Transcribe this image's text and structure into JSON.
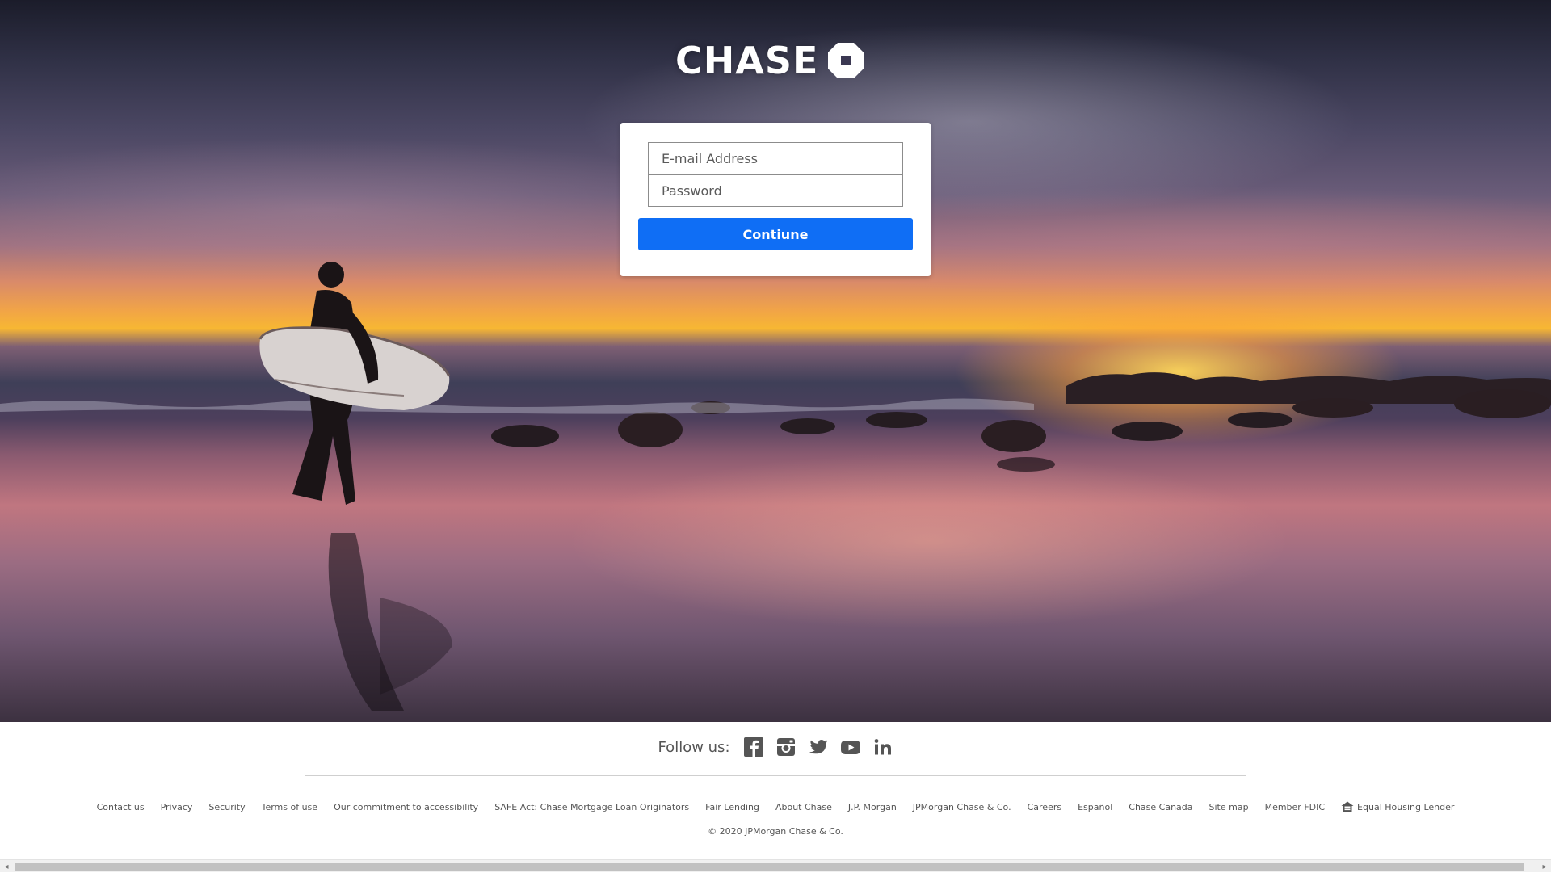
{
  "brand": {
    "name": "CHASE"
  },
  "login": {
    "email_placeholder": "E-mail Address",
    "password_placeholder": "Password",
    "continue_label": "Contiune",
    "button_color": "#0f6ef5"
  },
  "footer": {
    "follow_label": "Follow us:",
    "social_icons": [
      "facebook-icon",
      "instagram-icon",
      "twitter-icon",
      "youtube-icon",
      "linkedin-icon"
    ],
    "links": [
      "Contact us",
      "Privacy",
      "Security",
      "Terms of use",
      "Our commitment to accessibility",
      "SAFE Act: Chase Mortgage Loan Originators",
      "Fair Lending",
      "About Chase",
      "J.P. Morgan",
      "JPMorgan Chase & Co.",
      "Careers",
      "Español",
      "Chase Canada",
      "Site map",
      "Member FDIC"
    ],
    "equal_housing_label": "Equal Housing Lender",
    "copyright": "© 2020 JPMorgan Chase & Co."
  },
  "scrollbar": {
    "left_arrow": "◂",
    "right_arrow": "▸"
  }
}
